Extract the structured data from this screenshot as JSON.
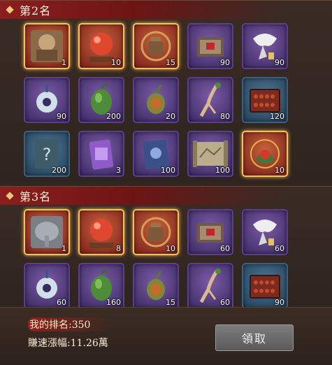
{
  "sections": [
    {
      "title": "第2名",
      "items": [
        {
          "name": "general-card-icon",
          "qty": "1",
          "tier": "gold"
        },
        {
          "name": "red-pearl-icon",
          "qty": "10",
          "tier": "gold"
        },
        {
          "name": "bronze-cauldron-icon",
          "qty": "15",
          "tier": "gold"
        },
        {
          "name": "red-seal-letter-icon",
          "qty": "90",
          "tier": "purple"
        },
        {
          "name": "white-scarf-icon",
          "qty": "90",
          "tier": "purple"
        },
        {
          "name": "jade-pendant-icon",
          "qty": "90",
          "tier": "purple"
        },
        {
          "name": "green-fruit-icon",
          "qty": "200",
          "tier": "purple"
        },
        {
          "name": "herb-gourd-icon",
          "qty": "20",
          "tier": "purple"
        },
        {
          "name": "ginseng-root-icon",
          "qty": "80",
          "tier": "purple"
        },
        {
          "name": "abacus-icon",
          "qty": "120",
          "tier": "blue"
        },
        {
          "name": "mystery-book-icon",
          "qty": "200",
          "tier": "blue"
        },
        {
          "name": "purple-token-icon",
          "qty": "3",
          "tier": "purple"
        },
        {
          "name": "blue-scroll-icon",
          "qty": "100",
          "tier": "purple"
        },
        {
          "name": "ancient-map-icon",
          "qty": "100",
          "tier": "purple"
        },
        {
          "name": "treasure-pouch-icon",
          "qty": "10",
          "tier": "gold"
        }
      ]
    },
    {
      "title": "第3名",
      "items": [
        {
          "name": "elephant-card-icon",
          "qty": "1",
          "tier": "gold"
        },
        {
          "name": "red-pearl-icon",
          "qty": "8",
          "tier": "gold"
        },
        {
          "name": "bronze-cauldron-icon",
          "qty": "10",
          "tier": "gold"
        },
        {
          "name": "red-seal-letter-icon",
          "qty": "60",
          "tier": "purple"
        },
        {
          "name": "white-scarf-icon",
          "qty": "60",
          "tier": "purple"
        },
        {
          "name": "jade-pendant-icon",
          "qty": "60",
          "tier": "purple"
        },
        {
          "name": "green-fruit-icon",
          "qty": "160",
          "tier": "purple"
        },
        {
          "name": "herb-gourd-icon",
          "qty": "15",
          "tier": "purple"
        },
        {
          "name": "ginseng-root-icon",
          "qty": "60",
          "tier": "purple"
        },
        {
          "name": "abacus-icon",
          "qty": "90",
          "tier": "blue"
        }
      ]
    }
  ],
  "footer": {
    "my_rank": "我的排名:350",
    "growth": "賺速漲幅:11.26萬",
    "claim_label": "領取"
  }
}
